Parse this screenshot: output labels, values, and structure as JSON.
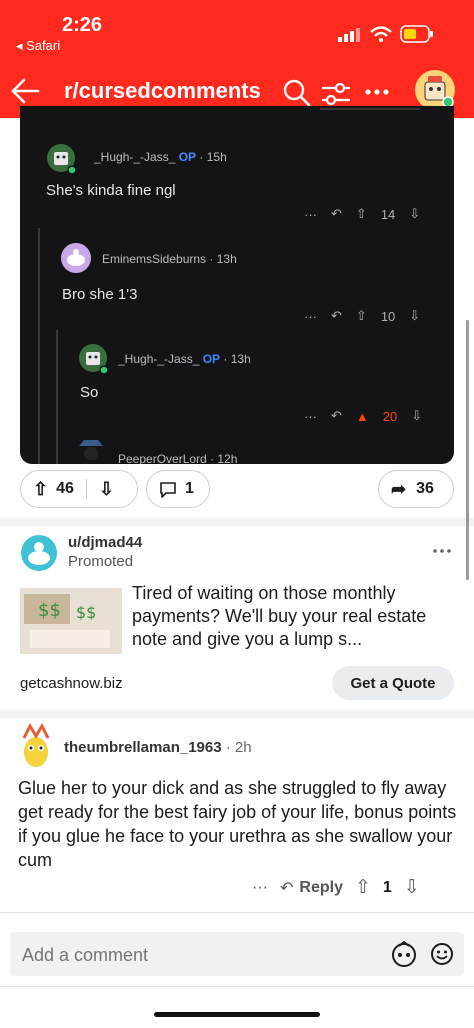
{
  "status_bar": {
    "time": "2:26",
    "back_app": "◂ Safari"
  },
  "header": {
    "subreddit": "r/cursedcomments"
  },
  "shot": {
    "comments": [
      {
        "author": "_Hugh-_-Jass_",
        "op_badge": "OP",
        "age": "· 15h",
        "body": "She's kinda fine ngl",
        "votes": "14"
      },
      {
        "author": "EminemsSideburns",
        "age": "· 13h",
        "body": "Bro she 1'3",
        "votes": "10"
      },
      {
        "author": "_Hugh-_-Jass_",
        "op_badge": "OP",
        "age": "· 13h",
        "body": "So",
        "votes": "20"
      },
      {
        "author": "PeeperOverLord",
        "age": "· 12h"
      }
    ]
  },
  "post_actions": {
    "upvotes": "46",
    "comments": "1",
    "shares": "36"
  },
  "ad": {
    "user": "u/djmad44",
    "label": "Promoted",
    "text": "Tired of waiting on those monthly payments? We'll buy your real estate note and give you a lump s...",
    "domain": "getcashnow.biz",
    "cta": "Get a Quote"
  },
  "comment": {
    "author": "theumbrellaman_1963",
    "age": "· 2h",
    "body": "Glue her to your dick and as she struggled to fly away get ready for the best fairy job of your life, bonus points if you glue he face to your urethra as she swallow your cum",
    "reply_label": "Reply",
    "votes": "1"
  },
  "composer": {
    "placeholder": "Add a comment"
  },
  "colors": {
    "brand_red": "#ff2a1d",
    "orange_upvote": "#ff4500",
    "op_blue": "#3b8cff"
  }
}
